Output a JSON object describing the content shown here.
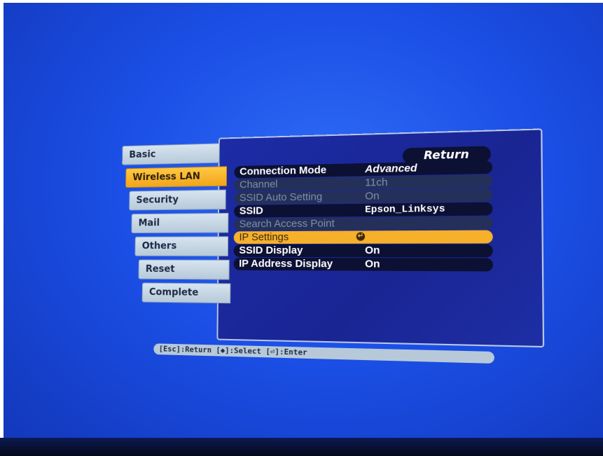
{
  "tabs": [
    "Basic",
    "Wireless LAN",
    "Security",
    "Mail",
    "Others",
    "Reset",
    "Complete"
  ],
  "active_tab": "Wireless LAN",
  "return_label": "Return",
  "settings": [
    {
      "label": "Connection Mode",
      "value": "Advanced",
      "state": "enabled"
    },
    {
      "label": "Channel",
      "value": "11ch",
      "state": "disabled"
    },
    {
      "label": "SSID Auto Setting",
      "value": "On",
      "state": "disabled"
    },
    {
      "label": "SSID",
      "value": "Epson_Linksys",
      "state": "enabled"
    },
    {
      "label": "Search Access Point",
      "value": "",
      "state": "disabled"
    },
    {
      "label": "IP Settings",
      "value": "",
      "state": "selected"
    },
    {
      "label": "SSID Display",
      "value": "On",
      "state": "enabled"
    },
    {
      "label": "IP Address Display",
      "value": "On",
      "state": "enabled"
    }
  ],
  "enter_icon": "enter-icon",
  "help_text": "[Esc]:Return [◆]:Select [⏎]:Enter",
  "colors": {
    "screen_blue": "#1b4fe6",
    "panel_blue": "#1c2ca6",
    "highlight_orange": "#f6b02a",
    "tab_gray": "#c8d8e6"
  }
}
